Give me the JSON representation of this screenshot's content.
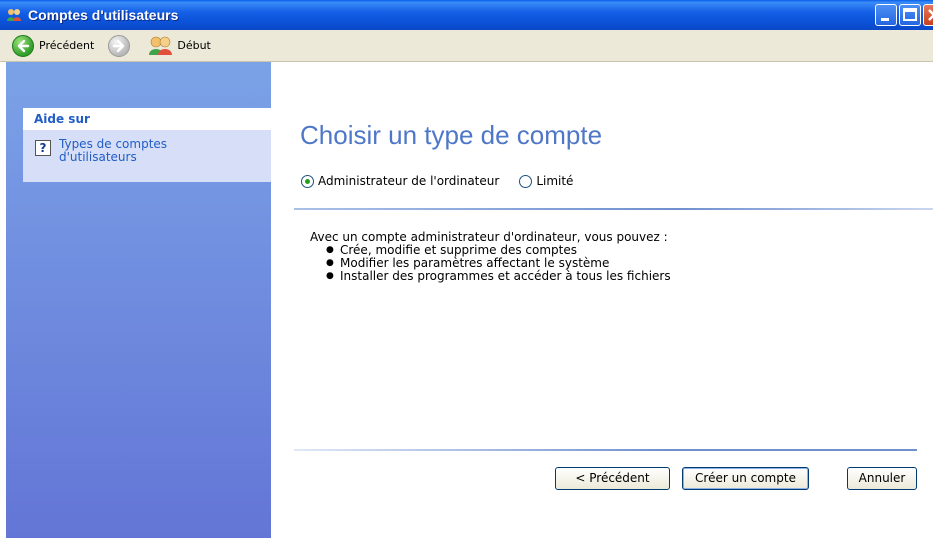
{
  "window": {
    "title": "Comptes d'utilisateurs"
  },
  "toolbar": {
    "back_label": "Précédent",
    "home_label": "Début"
  },
  "sidebar": {
    "help_header": "Aide sur",
    "help_items": [
      {
        "label": "Types de comptes d'utilisateurs"
      }
    ]
  },
  "main": {
    "title": "Choisir un type de compte",
    "account_types": [
      {
        "label": "Administrateur de l'ordinateur",
        "selected": true
      },
      {
        "label": "Limité",
        "selected": false
      }
    ],
    "description_intro": "Avec un compte administrateur d'ordinateur, vous pouvez :",
    "capabilities": [
      "Crée, modifie et supprime des comptes",
      "Modifier les paramètres affectant le système",
      "Installer des programmes et accéder à tous les fichiers"
    ]
  },
  "buttons": {
    "previous": "< Précédent",
    "create": "Créer un compte",
    "cancel": "Annuler"
  },
  "colors": {
    "title_bar": "#0c53d9",
    "sidebar_top": "#7ba2e7",
    "sidebar_bottom": "#6375d6",
    "heading": "#4f77c8",
    "link": "#215dc6"
  },
  "icons": {
    "title": "users-icon",
    "back": "back-arrow-icon",
    "forward": "forward-arrow-icon",
    "home": "users-icon",
    "help": "help-question-icon"
  }
}
